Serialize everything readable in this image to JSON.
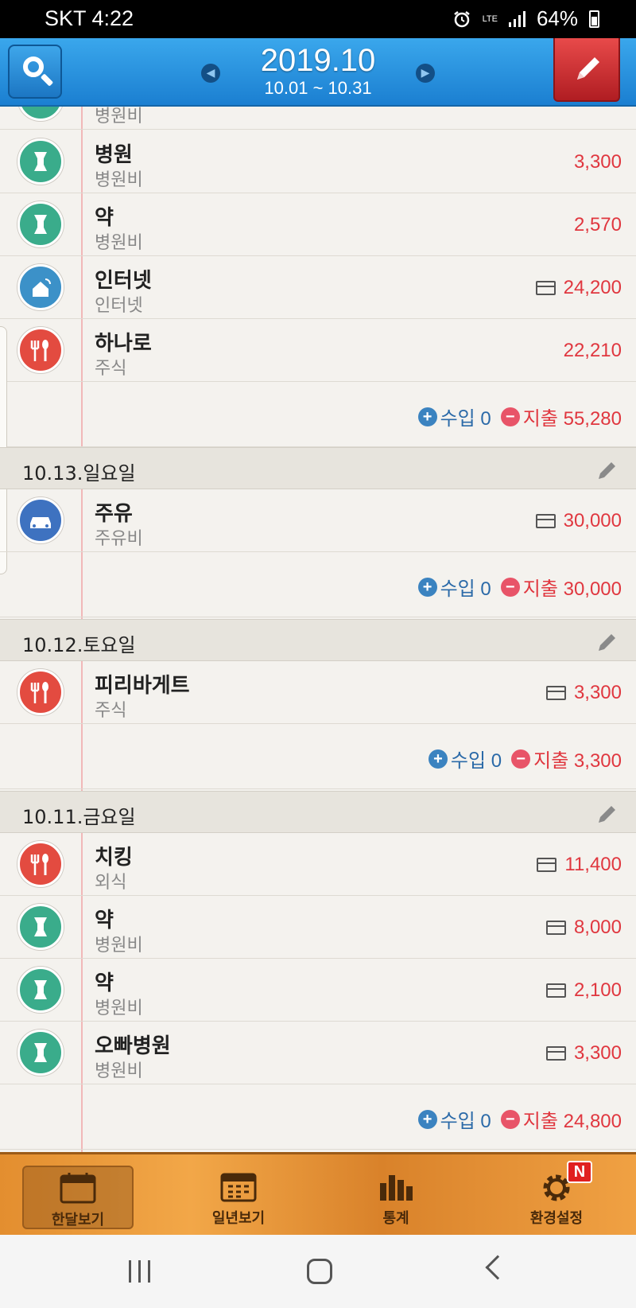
{
  "status_bar": {
    "carrier": "SKT 4:22",
    "network": "LTE",
    "battery": "64%"
  },
  "header": {
    "year_month": "2019.10",
    "range": "10.01 ~ 10.31",
    "search_icon": "search-icon",
    "write_icon": "pencil-icon",
    "accent": "#2b8fdc",
    "write_color": "#d23234"
  },
  "entries_partial": {
    "cat": "병원비"
  },
  "day_13": {
    "entries": [
      {
        "name": "병원",
        "cat": "병원비",
        "amount": "3,300"
      },
      {
        "name": "약",
        "cat": "병원비",
        "amount": "2,570"
      },
      {
        "name": "인터넷",
        "cat": "인터넷",
        "amount": "24,200"
      },
      {
        "name": "하나로",
        "cat": "주식",
        "amount": "22,210"
      }
    ],
    "summary": {
      "income": "수입 0",
      "expense": "지출 55,280"
    }
  },
  "day_sun": {
    "date": "10.13.일요일",
    "entries": [
      {
        "name": "주유",
        "cat": "주유비",
        "amount": "30,000"
      }
    ],
    "summary": {
      "income": "수입 0",
      "expense": "지출 30,000"
    }
  },
  "day_sat": {
    "date": "10.12.토요일",
    "entries": [
      {
        "name": "피리바게트",
        "cat": "주식",
        "amount": "3,300"
      }
    ],
    "summary": {
      "income": "수입 0",
      "expense": "지출 3,300"
    }
  },
  "day_fri": {
    "date": "10.11.금요일",
    "entries": [
      {
        "name": "치킹",
        "cat": "외식",
        "amount": "11,400"
      },
      {
        "name": "약",
        "cat": "병원비",
        "amount": "8,000"
      },
      {
        "name": "약",
        "cat": "병원비",
        "amount": "2,100"
      },
      {
        "name": "오빠병원",
        "cat": "병원비",
        "amount": "3,300"
      }
    ],
    "summary": {
      "income": "수입 0",
      "expense": "지출 24,800"
    }
  },
  "tabbar": {
    "tabs": [
      {
        "label": "한달보기",
        "icon": "calendar-month-icon"
      },
      {
        "label": "일년보기",
        "icon": "calendar-year-icon"
      },
      {
        "label": "통계",
        "icon": "bar-chart-icon"
      },
      {
        "label": "환경설정",
        "icon": "gear-icon"
      }
    ],
    "badge": "N"
  },
  "colors": {
    "expense": "#e0373f",
    "income": "#2b6aa8",
    "medical": "#3aac8b",
    "food": "#e34b40",
    "internet": "#3c91c8",
    "car": "#3e72c0"
  }
}
